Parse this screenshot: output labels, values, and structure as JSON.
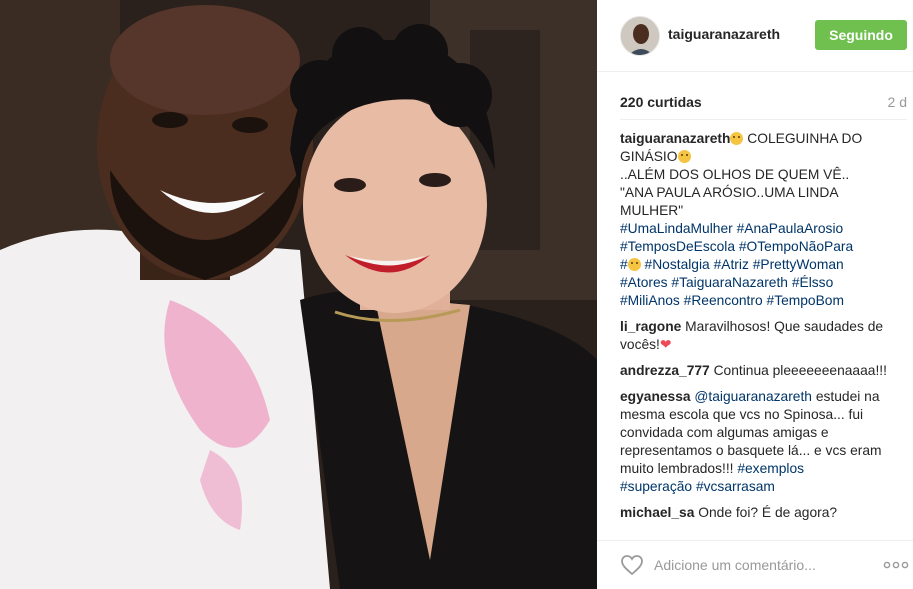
{
  "post": {
    "username": "taiguaranazareth",
    "follow_label": "Seguindo",
    "likes_text": "220 curtidas",
    "age_text": "2 d",
    "accent_color": "#70c050",
    "link_color": "#003569"
  },
  "caption": {
    "user": "taiguaranazareth",
    "line1_a": " COLEGUINHA DO",
    "line2": "GINÁSIO",
    "line3": "..ALÉM DOS OLHOS DE QUEM VÊ..",
    "line4": "\"ANA PAULA ARÓSIO..UMA LINDA",
    "line5": "MULHER\"",
    "tags": [
      "#UmaLindaMulher",
      "#AnaPaulaArosio",
      "#TemposDeEscola",
      "#OTempoNãoPara",
      "#",
      "#Nostalgia",
      "#Atriz",
      "#PrettyWoman",
      "#Atores",
      "#TaiguaraNazareth",
      "#Élsso",
      "#MiliAnos",
      "#Reencontro",
      "#TempoBom"
    ]
  },
  "comments": [
    {
      "user": "li_ragone",
      "text": " Maravilhosos! Que saudades de vocês!"
    },
    {
      "user": "andrezza_777",
      "text": " Continua pleeeeeeenaaaa!!!"
    },
    {
      "user": "egyanessa",
      "mention": "@taiguaranazareth",
      "text": " estudei na mesma escola que vcs no Spinosa... fui convidada com algumas amigas e representamos o basquete lá... e vcs eram muito lembrados!!! ",
      "tag1": "#exemplos",
      "tag2": "#superação",
      "tag3": "#vcsarrasam"
    },
    {
      "user": "michael_sa",
      "text": " Onde foi? É de agora?"
    }
  ],
  "footer": {
    "comment_placeholder": "Adicione um comentário...",
    "like_icon": "heart-outline-icon",
    "more_icon": "more-options-icon"
  }
}
